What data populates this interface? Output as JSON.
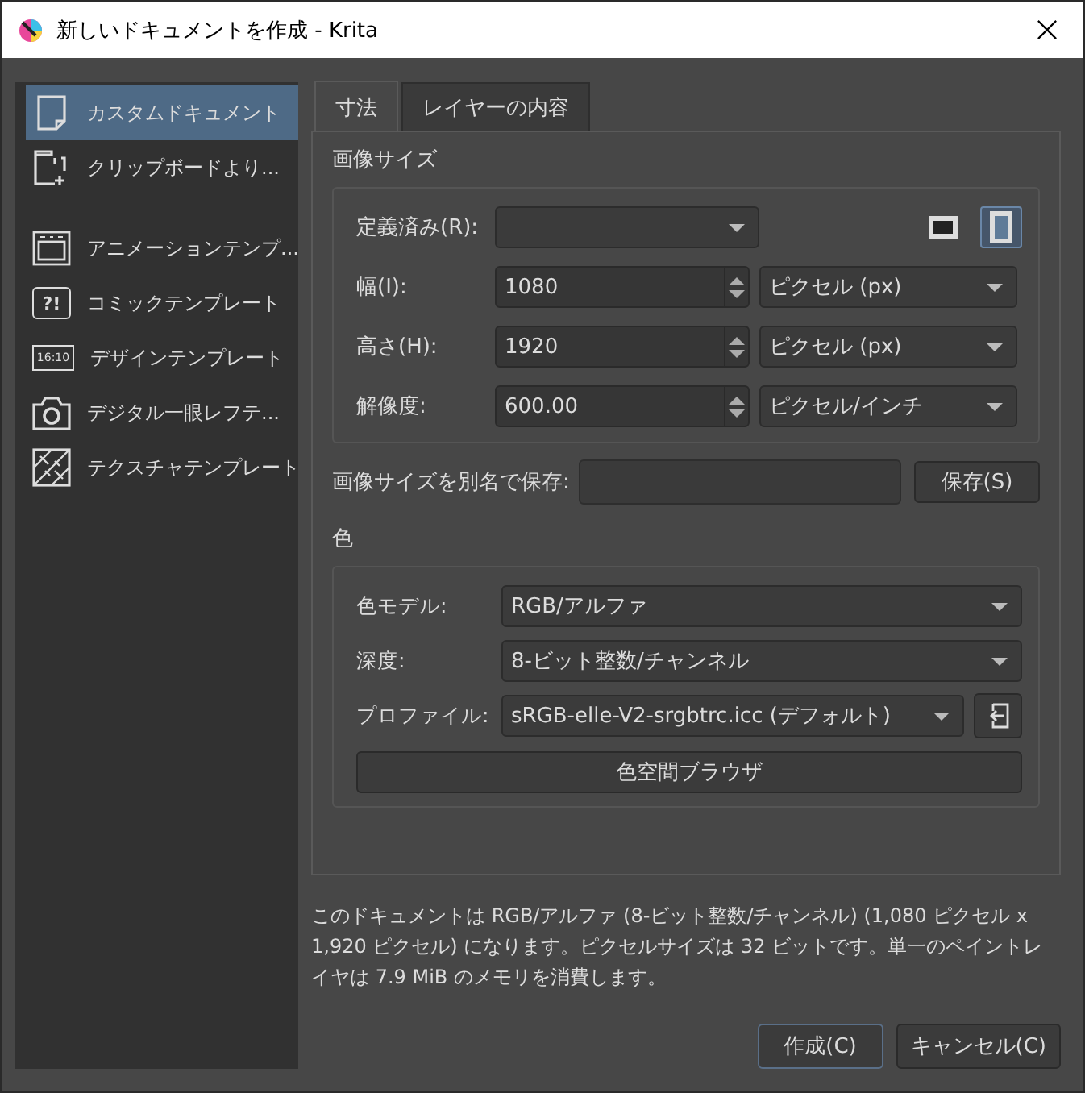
{
  "window": {
    "title": "新しいドキュメントを作成 - Krita"
  },
  "sidebar": {
    "groups": [
      [
        {
          "label": "カスタムドキュメント",
          "kind": "document",
          "selected": true
        },
        {
          "label": "クリップボードより...",
          "kind": "clipboard",
          "selected": false
        }
      ],
      [
        {
          "label": "アニメーションテンプ...",
          "kind": "animation",
          "selected": false
        },
        {
          "label": "コミックテンプレート",
          "kind": "comic",
          "icon_text": "?!",
          "selected": false
        },
        {
          "label": "デザインテンプレート",
          "kind": "design",
          "icon_text": "16:10",
          "selected": false
        },
        {
          "label": "デジタル一眼レフテ...",
          "kind": "camera",
          "selected": false
        },
        {
          "label": "テクスチャテンプレート",
          "kind": "texture",
          "selected": false
        }
      ]
    ]
  },
  "tabs": [
    {
      "label": "寸法",
      "selected": true
    },
    {
      "label": "レイヤーの内容",
      "selected": false
    }
  ],
  "image_size": {
    "title": "画像サイズ",
    "predefined": {
      "label": "定義済み(R):"
    },
    "orientations": [
      {
        "kind": "landscape",
        "selected": false
      },
      {
        "kind": "portrait",
        "selected": true
      }
    ],
    "fields": [
      {
        "label": "幅(I):",
        "value": "1080",
        "unit": "ピクセル (px)"
      },
      {
        "label": "高さ(H):",
        "value": "1920",
        "unit": "ピクセル (px)"
      },
      {
        "label": "解像度:",
        "value": "600.00",
        "unit": "ピクセル/インチ"
      }
    ],
    "save_as": {
      "label": "画像サイズを別名で保存:",
      "button": "保存(S)"
    }
  },
  "color": {
    "title": "色",
    "rows": [
      {
        "label": "色モデル:",
        "value": "RGB/アルファ"
      },
      {
        "label": "深度:",
        "value": "8-ビット整数/チャンネル"
      },
      {
        "label": "プロファイル:",
        "value": "sRGB-elle-V2-srgbtrc.icc (デフォルト)",
        "import_button": true
      }
    ],
    "browser_button": "色空間ブラウザ"
  },
  "description": "このドキュメントは RGB/アルファ (8-ビット整数/チャンネル) (1,080 ピクセル x 1,920 ピクセル) になります。ピクセルサイズは 32 ビットです。単一のペイントレイヤは 7.9 MiB のメモリを消費します。",
  "buttons": [
    {
      "label": "作成(C)",
      "kind": "default"
    },
    {
      "label": "キャンセル(C)",
      "kind": "normal"
    }
  ]
}
